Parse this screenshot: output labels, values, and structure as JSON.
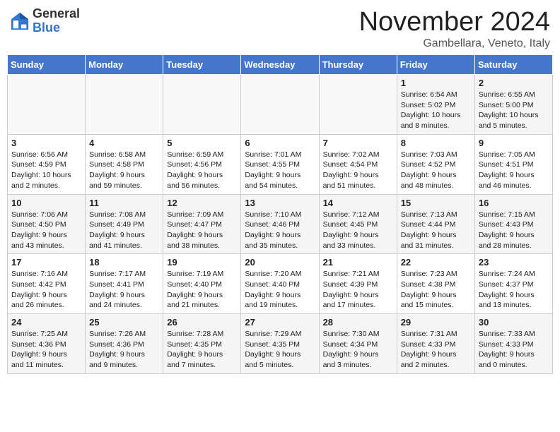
{
  "logo": {
    "general": "General",
    "blue": "Blue"
  },
  "title": "November 2024",
  "location": "Gambellara, Veneto, Italy",
  "days_of_week": [
    "Sunday",
    "Monday",
    "Tuesday",
    "Wednesday",
    "Thursday",
    "Friday",
    "Saturday"
  ],
  "weeks": [
    [
      {
        "day": "",
        "info": ""
      },
      {
        "day": "",
        "info": ""
      },
      {
        "day": "",
        "info": ""
      },
      {
        "day": "",
        "info": ""
      },
      {
        "day": "",
        "info": ""
      },
      {
        "day": "1",
        "info": "Sunrise: 6:54 AM\nSunset: 5:02 PM\nDaylight: 10 hours and 8 minutes."
      },
      {
        "day": "2",
        "info": "Sunrise: 6:55 AM\nSunset: 5:00 PM\nDaylight: 10 hours and 5 minutes."
      }
    ],
    [
      {
        "day": "3",
        "info": "Sunrise: 6:56 AM\nSunset: 4:59 PM\nDaylight: 10 hours and 2 minutes."
      },
      {
        "day": "4",
        "info": "Sunrise: 6:58 AM\nSunset: 4:58 PM\nDaylight: 9 hours and 59 minutes."
      },
      {
        "day": "5",
        "info": "Sunrise: 6:59 AM\nSunset: 4:56 PM\nDaylight: 9 hours and 56 minutes."
      },
      {
        "day": "6",
        "info": "Sunrise: 7:01 AM\nSunset: 4:55 PM\nDaylight: 9 hours and 54 minutes."
      },
      {
        "day": "7",
        "info": "Sunrise: 7:02 AM\nSunset: 4:54 PM\nDaylight: 9 hours and 51 minutes."
      },
      {
        "day": "8",
        "info": "Sunrise: 7:03 AM\nSunset: 4:52 PM\nDaylight: 9 hours and 48 minutes."
      },
      {
        "day": "9",
        "info": "Sunrise: 7:05 AM\nSunset: 4:51 PM\nDaylight: 9 hours and 46 minutes."
      }
    ],
    [
      {
        "day": "10",
        "info": "Sunrise: 7:06 AM\nSunset: 4:50 PM\nDaylight: 9 hours and 43 minutes."
      },
      {
        "day": "11",
        "info": "Sunrise: 7:08 AM\nSunset: 4:49 PM\nDaylight: 9 hours and 41 minutes."
      },
      {
        "day": "12",
        "info": "Sunrise: 7:09 AM\nSunset: 4:47 PM\nDaylight: 9 hours and 38 minutes."
      },
      {
        "day": "13",
        "info": "Sunrise: 7:10 AM\nSunset: 4:46 PM\nDaylight: 9 hours and 35 minutes."
      },
      {
        "day": "14",
        "info": "Sunrise: 7:12 AM\nSunset: 4:45 PM\nDaylight: 9 hours and 33 minutes."
      },
      {
        "day": "15",
        "info": "Sunrise: 7:13 AM\nSunset: 4:44 PM\nDaylight: 9 hours and 31 minutes."
      },
      {
        "day": "16",
        "info": "Sunrise: 7:15 AM\nSunset: 4:43 PM\nDaylight: 9 hours and 28 minutes."
      }
    ],
    [
      {
        "day": "17",
        "info": "Sunrise: 7:16 AM\nSunset: 4:42 PM\nDaylight: 9 hours and 26 minutes."
      },
      {
        "day": "18",
        "info": "Sunrise: 7:17 AM\nSunset: 4:41 PM\nDaylight: 9 hours and 24 minutes."
      },
      {
        "day": "19",
        "info": "Sunrise: 7:19 AM\nSunset: 4:40 PM\nDaylight: 9 hours and 21 minutes."
      },
      {
        "day": "20",
        "info": "Sunrise: 7:20 AM\nSunset: 4:40 PM\nDaylight: 9 hours and 19 minutes."
      },
      {
        "day": "21",
        "info": "Sunrise: 7:21 AM\nSunset: 4:39 PM\nDaylight: 9 hours and 17 minutes."
      },
      {
        "day": "22",
        "info": "Sunrise: 7:23 AM\nSunset: 4:38 PM\nDaylight: 9 hours and 15 minutes."
      },
      {
        "day": "23",
        "info": "Sunrise: 7:24 AM\nSunset: 4:37 PM\nDaylight: 9 hours and 13 minutes."
      }
    ],
    [
      {
        "day": "24",
        "info": "Sunrise: 7:25 AM\nSunset: 4:36 PM\nDaylight: 9 hours and 11 minutes."
      },
      {
        "day": "25",
        "info": "Sunrise: 7:26 AM\nSunset: 4:36 PM\nDaylight: 9 hours and 9 minutes."
      },
      {
        "day": "26",
        "info": "Sunrise: 7:28 AM\nSunset: 4:35 PM\nDaylight: 9 hours and 7 minutes."
      },
      {
        "day": "27",
        "info": "Sunrise: 7:29 AM\nSunset: 4:35 PM\nDaylight: 9 hours and 5 minutes."
      },
      {
        "day": "28",
        "info": "Sunrise: 7:30 AM\nSunset: 4:34 PM\nDaylight: 9 hours and 3 minutes."
      },
      {
        "day": "29",
        "info": "Sunrise: 7:31 AM\nSunset: 4:33 PM\nDaylight: 9 hours and 2 minutes."
      },
      {
        "day": "30",
        "info": "Sunrise: 7:33 AM\nSunset: 4:33 PM\nDaylight: 9 hours and 0 minutes."
      }
    ]
  ]
}
